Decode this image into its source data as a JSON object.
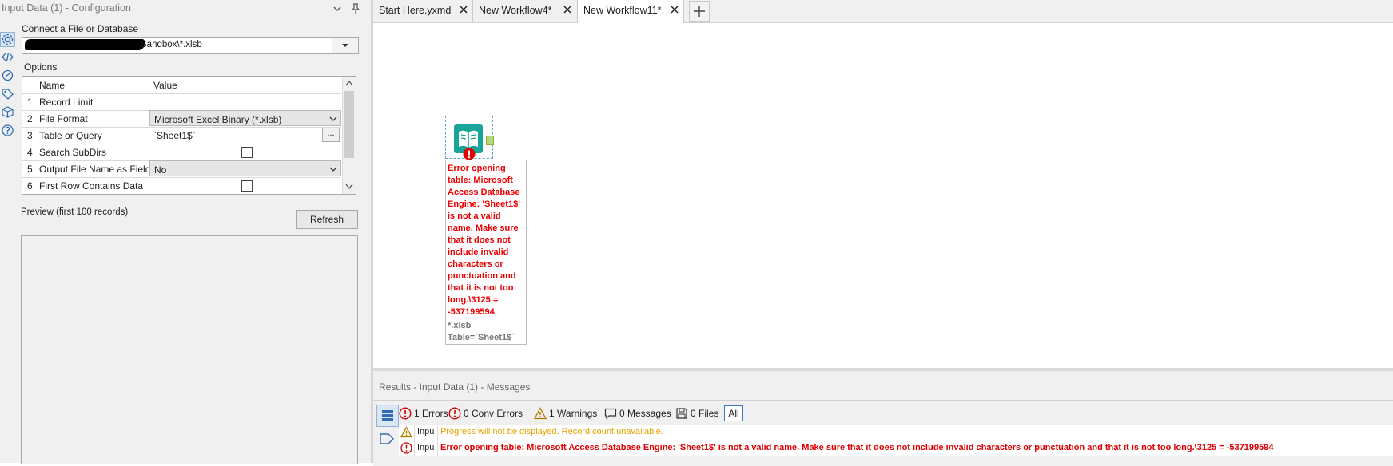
{
  "left_panel": {
    "title": "Input Data (1) - Configuration",
    "connect_label": "Connect a File or Database",
    "file_path": "Sandbox\\*.xlsb",
    "options_label": "Options",
    "grid_headers": {
      "name": "Name",
      "value": "Value"
    },
    "rows": [
      {
        "num": "1",
        "name": "Record Limit",
        "value": ""
      },
      {
        "num": "2",
        "name": "File Format",
        "value": "Microsoft Excel Binary (*.xlsb)"
      },
      {
        "num": "3",
        "name": "Table or Query",
        "value": "`Sheet1$`",
        "button": "..."
      },
      {
        "num": "4",
        "name": "Search SubDirs",
        "checked": false
      },
      {
        "num": "5",
        "name": "Output File Name as Field",
        "value": "No"
      },
      {
        "num": "6",
        "name": "First Row Contains Data",
        "checked": false
      }
    ],
    "preview_label": "Preview (first 100 records)",
    "refresh_label": "Refresh"
  },
  "tabs": [
    {
      "label": "Start Here.yxmd",
      "active": false
    },
    {
      "label": "New Workflow4*",
      "active": false
    },
    {
      "label": "New Workflow11*",
      "active": true
    }
  ],
  "canvas": {
    "error_annotation": "Error opening table: Microsoft Access Database Engine: 'Sheet1$' is not a valid name. Make sure that it does not include invalid characters or punctuation and that it is not too long.\\3125 = -537199594",
    "info_line1": "*.xlsb",
    "info_line2": "Table=`Sheet1$`"
  },
  "results": {
    "title": "Results - Input Data (1) - Messages",
    "filters": {
      "errors": "1 Errors",
      "conv_errors": "0 Conv Errors",
      "warnings": "1 Warnings",
      "messages": "0 Messages",
      "files": "0 Files",
      "all": "All"
    },
    "messages": [
      {
        "type": "warning",
        "tool": "Inpu",
        "text": "Progress will not be displayed.  Record count unavailable."
      },
      {
        "type": "error",
        "tool": "Inpu",
        "text": "Error opening table: Microsoft Access Database Engine: 'Sheet1$' is not a valid name. Make sure that it does not include invalid characters or punctuation and that it is not too long.\\3125 = -537199594"
      }
    ]
  },
  "colors": {
    "error": "#e00000",
    "warning": "#e6a200",
    "accent": "#3c78c8",
    "tool_teal": "#1aa39a"
  }
}
